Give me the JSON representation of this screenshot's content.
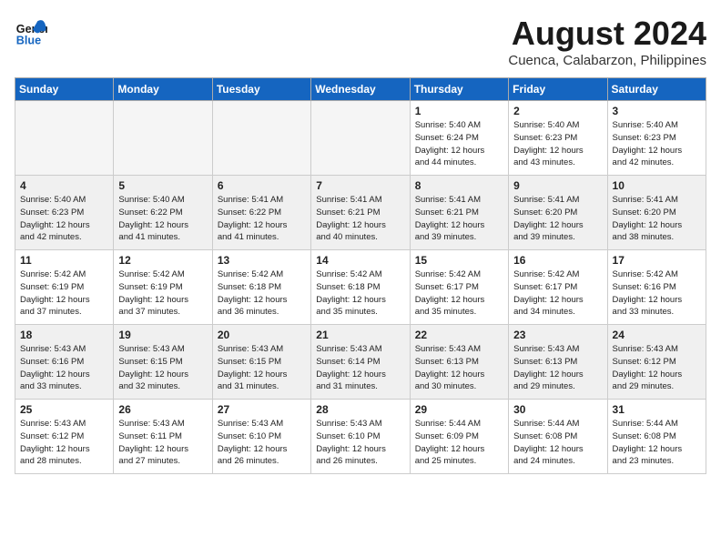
{
  "logo": {
    "line1": "General",
    "line2": "Blue"
  },
  "title": "August 2024",
  "subtitle": "Cuenca, Calabarzon, Philippines",
  "headers": [
    "Sunday",
    "Monday",
    "Tuesday",
    "Wednesday",
    "Thursday",
    "Friday",
    "Saturday"
  ],
  "weeks": [
    [
      {
        "num": "",
        "info": "",
        "empty": true
      },
      {
        "num": "",
        "info": "",
        "empty": true
      },
      {
        "num": "",
        "info": "",
        "empty": true
      },
      {
        "num": "",
        "info": "",
        "empty": true
      },
      {
        "num": "1",
        "info": "Sunrise: 5:40 AM\nSunset: 6:24 PM\nDaylight: 12 hours\nand 44 minutes."
      },
      {
        "num": "2",
        "info": "Sunrise: 5:40 AM\nSunset: 6:23 PM\nDaylight: 12 hours\nand 43 minutes."
      },
      {
        "num": "3",
        "info": "Sunrise: 5:40 AM\nSunset: 6:23 PM\nDaylight: 12 hours\nand 42 minutes."
      }
    ],
    [
      {
        "num": "4",
        "info": "Sunrise: 5:40 AM\nSunset: 6:23 PM\nDaylight: 12 hours\nand 42 minutes."
      },
      {
        "num": "5",
        "info": "Sunrise: 5:40 AM\nSunset: 6:22 PM\nDaylight: 12 hours\nand 41 minutes."
      },
      {
        "num": "6",
        "info": "Sunrise: 5:41 AM\nSunset: 6:22 PM\nDaylight: 12 hours\nand 41 minutes."
      },
      {
        "num": "7",
        "info": "Sunrise: 5:41 AM\nSunset: 6:21 PM\nDaylight: 12 hours\nand 40 minutes."
      },
      {
        "num": "8",
        "info": "Sunrise: 5:41 AM\nSunset: 6:21 PM\nDaylight: 12 hours\nand 39 minutes."
      },
      {
        "num": "9",
        "info": "Sunrise: 5:41 AM\nSunset: 6:20 PM\nDaylight: 12 hours\nand 39 minutes."
      },
      {
        "num": "10",
        "info": "Sunrise: 5:41 AM\nSunset: 6:20 PM\nDaylight: 12 hours\nand 38 minutes."
      }
    ],
    [
      {
        "num": "11",
        "info": "Sunrise: 5:42 AM\nSunset: 6:19 PM\nDaylight: 12 hours\nand 37 minutes."
      },
      {
        "num": "12",
        "info": "Sunrise: 5:42 AM\nSunset: 6:19 PM\nDaylight: 12 hours\nand 37 minutes."
      },
      {
        "num": "13",
        "info": "Sunrise: 5:42 AM\nSunset: 6:18 PM\nDaylight: 12 hours\nand 36 minutes."
      },
      {
        "num": "14",
        "info": "Sunrise: 5:42 AM\nSunset: 6:18 PM\nDaylight: 12 hours\nand 35 minutes."
      },
      {
        "num": "15",
        "info": "Sunrise: 5:42 AM\nSunset: 6:17 PM\nDaylight: 12 hours\nand 35 minutes."
      },
      {
        "num": "16",
        "info": "Sunrise: 5:42 AM\nSunset: 6:17 PM\nDaylight: 12 hours\nand 34 minutes."
      },
      {
        "num": "17",
        "info": "Sunrise: 5:42 AM\nSunset: 6:16 PM\nDaylight: 12 hours\nand 33 minutes."
      }
    ],
    [
      {
        "num": "18",
        "info": "Sunrise: 5:43 AM\nSunset: 6:16 PM\nDaylight: 12 hours\nand 33 minutes."
      },
      {
        "num": "19",
        "info": "Sunrise: 5:43 AM\nSunset: 6:15 PM\nDaylight: 12 hours\nand 32 minutes."
      },
      {
        "num": "20",
        "info": "Sunrise: 5:43 AM\nSunset: 6:15 PM\nDaylight: 12 hours\nand 31 minutes."
      },
      {
        "num": "21",
        "info": "Sunrise: 5:43 AM\nSunset: 6:14 PM\nDaylight: 12 hours\nand 31 minutes."
      },
      {
        "num": "22",
        "info": "Sunrise: 5:43 AM\nSunset: 6:13 PM\nDaylight: 12 hours\nand 30 minutes."
      },
      {
        "num": "23",
        "info": "Sunrise: 5:43 AM\nSunset: 6:13 PM\nDaylight: 12 hours\nand 29 minutes."
      },
      {
        "num": "24",
        "info": "Sunrise: 5:43 AM\nSunset: 6:12 PM\nDaylight: 12 hours\nand 29 minutes."
      }
    ],
    [
      {
        "num": "25",
        "info": "Sunrise: 5:43 AM\nSunset: 6:12 PM\nDaylight: 12 hours\nand 28 minutes."
      },
      {
        "num": "26",
        "info": "Sunrise: 5:43 AM\nSunset: 6:11 PM\nDaylight: 12 hours\nand 27 minutes."
      },
      {
        "num": "27",
        "info": "Sunrise: 5:43 AM\nSunset: 6:10 PM\nDaylight: 12 hours\nand 26 minutes."
      },
      {
        "num": "28",
        "info": "Sunrise: 5:43 AM\nSunset: 6:10 PM\nDaylight: 12 hours\nand 26 minutes."
      },
      {
        "num": "29",
        "info": "Sunrise: 5:44 AM\nSunset: 6:09 PM\nDaylight: 12 hours\nand 25 minutes."
      },
      {
        "num": "30",
        "info": "Sunrise: 5:44 AM\nSunset: 6:08 PM\nDaylight: 12 hours\nand 24 minutes."
      },
      {
        "num": "31",
        "info": "Sunrise: 5:44 AM\nSunset: 6:08 PM\nDaylight: 12 hours\nand 23 minutes."
      }
    ]
  ]
}
